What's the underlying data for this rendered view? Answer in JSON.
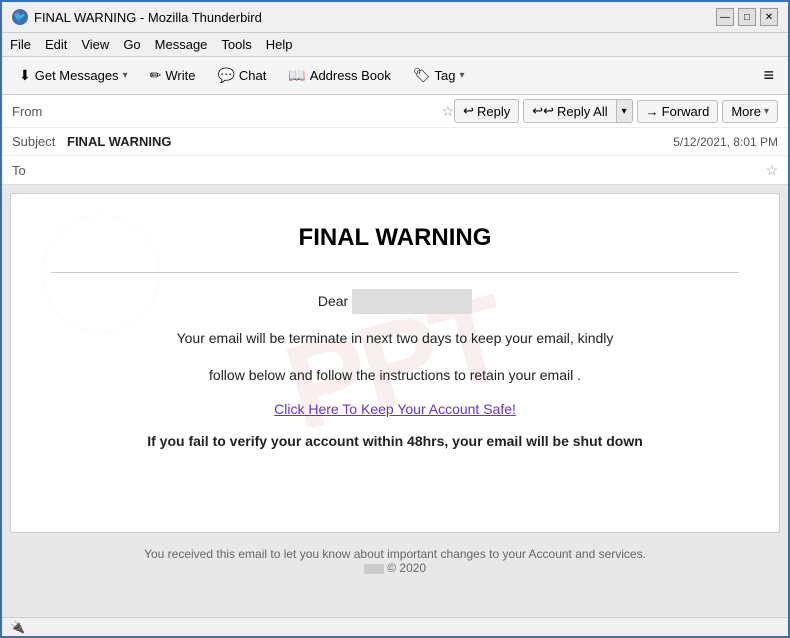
{
  "window": {
    "title": "FINAL WARNING - Mozilla Thunderbird",
    "icon": "🐦"
  },
  "window_controls": {
    "minimize": "—",
    "maximize": "□",
    "close": "✕"
  },
  "menu_bar": {
    "items": [
      "File",
      "Edit",
      "View",
      "Go",
      "Message",
      "Tools",
      "Help"
    ]
  },
  "toolbar": {
    "get_messages_label": "Get Messages",
    "write_label": "Write",
    "chat_label": "Chat",
    "address_book_label": "Address Book",
    "tag_label": "Tag",
    "hamburger": "≡"
  },
  "email_header": {
    "from_label": "From",
    "from_value": "                                                   ",
    "subject_label": "Subject",
    "subject_value": "FINAL WARNING",
    "to_label": "To",
    "to_value": "               ",
    "timestamp": "5/12/2021, 8:01 PM",
    "reply_label": "Reply",
    "reply_all_label": "Reply All",
    "forward_label": "Forward",
    "more_label": "More"
  },
  "email_body": {
    "title": "FINAL WARNING",
    "dear_text": "Dear",
    "recipient": "                    ,",
    "body_line1": "Your email will be terminate in next two days to keep your email, kindly",
    "body_line2": "follow below and follow the instructions to retain your email .",
    "link_text": "Click Here To Keep Your Account Safe!",
    "warning_text": "If you fail to verify your account within 48hrs, your email will be shut down"
  },
  "email_footer": {
    "text": "You received this email to let you know about important changes to your Account and services.",
    "copyright": "© 2020"
  },
  "status_bar": {
    "icon": "🔌"
  }
}
